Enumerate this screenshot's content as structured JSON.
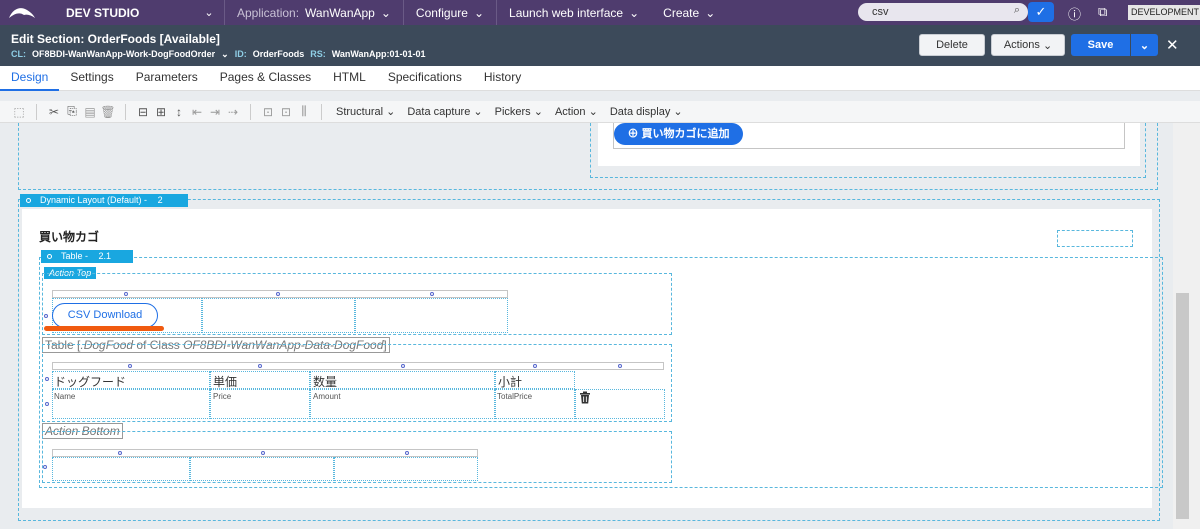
{
  "topbar": {
    "studio": "DEV STUDIO",
    "application_label": "Application:",
    "application_value": "WanWanApp",
    "configure": "Configure",
    "launch": "Launch web interface",
    "create": "Create",
    "search_value": "csv",
    "environment": "DEVELOPMENT"
  },
  "header": {
    "title": "Edit  Section: OrderFoods [Available]",
    "cl_key": "CL:",
    "cl_value": "OF8BDI-WanWanApp-Work-DogFoodOrder",
    "id_key": "ID:",
    "id_value": "OrderFoods",
    "rs_key": "RS:",
    "rs_value": "WanWanApp:01-01-01",
    "delete_label": "Delete",
    "actions_label": "Actions",
    "save_label": "Save"
  },
  "tabs": [
    {
      "label": "Design"
    },
    {
      "label": "Settings"
    },
    {
      "label": "Parameters"
    },
    {
      "label": "Pages & Classes"
    },
    {
      "label": "HTML"
    },
    {
      "label": "Specifications"
    },
    {
      "label": "History"
    }
  ],
  "toolbar": {
    "menus": [
      "Structural",
      "Data capture",
      "Pickers",
      "Action",
      "Data display"
    ]
  },
  "canvas": {
    "add_to_cart": "⊕ 買い物カゴに追加",
    "dynamic_layout_label": "Dynamic Layout (Default) -",
    "dynamic_layout_num": "2",
    "cart_heading": "買い物カゴ",
    "table_label": "Table -",
    "table_num": "2.1",
    "action_top": "Action Top",
    "csv_button": "CSV Download",
    "table_desc_prefix": "Table [",
    "table_desc_page": ".DogFood",
    "table_desc_mid": " of Class ",
    "table_desc_class": "OF8BDI-WanWanApp-Data-DogFood",
    "table_desc_suffix": "]",
    "columns": [
      "ドッグフード",
      "単価",
      "数量",
      "小計"
    ],
    "fields": [
      "Name",
      "Price",
      "Amount",
      "TotalPrice"
    ],
    "action_bottom": "Action Bottom"
  },
  "colors": {
    "topbar": "#4f3c6e",
    "header": "#3c4a5a",
    "accent": "#1f6fe5",
    "layout_chip": "#19a7e0",
    "highlight": "#f05a10"
  }
}
